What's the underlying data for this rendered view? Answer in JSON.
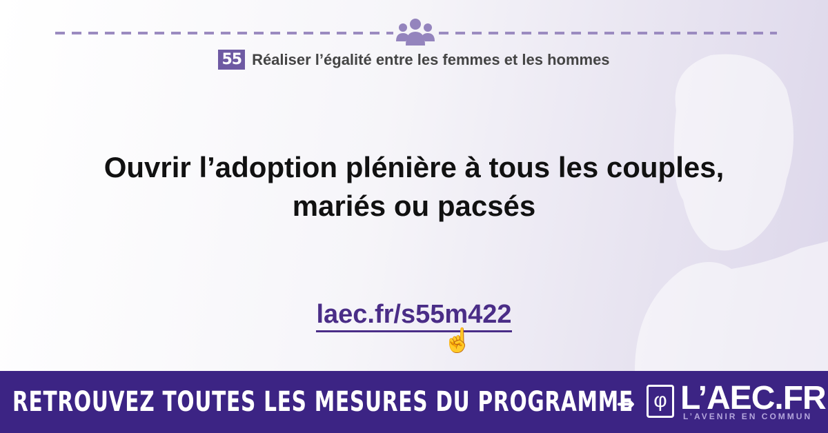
{
  "header": {
    "number": "55",
    "theme": "Réaliser l’égalité entre les femmes et les hommes",
    "icon": "people-group-icon"
  },
  "main": {
    "title_line1": "Ouvrir l’adoption plénière à tous les couples,",
    "title_line2": "mariés ou pacsés",
    "link": "laec.fr/s55m422"
  },
  "footer": {
    "cta": "RETROUVEZ TOUTES LES MESURES DU PROGRAMME",
    "brand": "L’AEC.FR",
    "tagline": "L’AVENIR EN COMMUN"
  },
  "colors": {
    "accent": "#3c2484",
    "badge": "#6e5aa3",
    "link": "#4a2d87"
  }
}
